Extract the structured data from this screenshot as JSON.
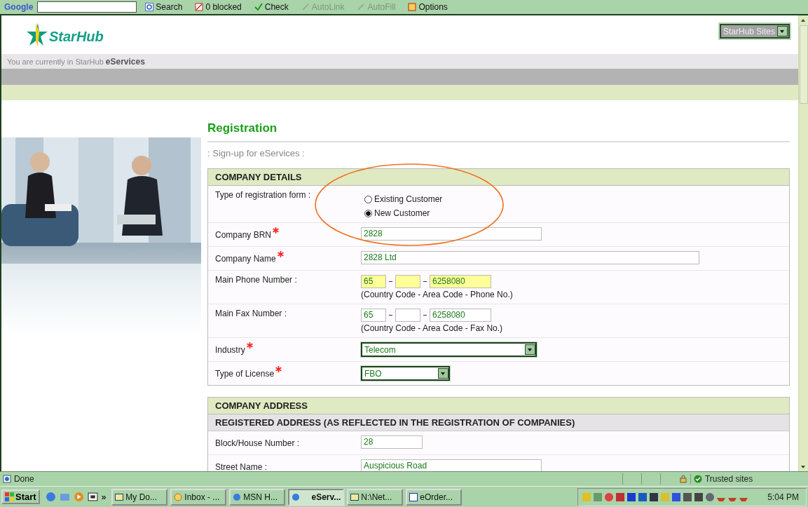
{
  "toolbar": {
    "brand": "Google",
    "items": [
      {
        "label": "Search",
        "kind": "search"
      },
      {
        "label": "0 blocked",
        "kind": "blocked"
      },
      {
        "label": "Check",
        "kind": "check"
      },
      {
        "label": "AutoLink",
        "kind": "disabled"
      },
      {
        "label": "AutoFill",
        "kind": "disabled"
      },
      {
        "label": "Options",
        "kind": "options"
      }
    ]
  },
  "header": {
    "logo": "StarHub",
    "sites_select": "StarHub Sites",
    "breadcrumb": "You are currently in StarHub **eServices**"
  },
  "title": "Registration",
  "subtitle": ": Sign-up for eServices :",
  "sections": [
    {
      "title": "COMPANY DETAILS",
      "rows": [
        {
          "kind": "radio",
          "label": "Type of registration form :",
          "required": false,
          "options": [
            {
              "label": "Existing Customer",
              "selected": false
            },
            {
              "label": "New Customer",
              "selected": true
            }
          ]
        },
        {
          "kind": "text",
          "label": "Company BRN",
          "required": true,
          "value": "2828",
          "wide": false
        },
        {
          "kind": "text",
          "label": "Company Name",
          "required": true,
          "value": "2828 Ltd",
          "wide": true
        },
        {
          "kind": "phone",
          "label": "Main Phone Number :",
          "required": false,
          "parts": [
            {
              "value": "65",
              "highlighted": true
            },
            {
              "highlighted": true
            },
            {
              "value": "6258080",
              "highlighted": true
            }
          ],
          "hint": "(Country Code - Area Code - Phone No.)"
        },
        {
          "kind": "phone",
          "label": "Main Fax Number :",
          "required": false,
          "parts": [
            {
              "value": "65",
              "highlighted": false
            },
            {
              "highlighted": false
            },
            {
              "value": "6258080",
              "highlighted": false
            }
          ],
          "hint": "(Country Code - Area Code - Fax No.)"
        },
        {
          "kind": "select",
          "label": "Industry",
          "required": true,
          "value": "Telecom",
          "wide": true
        },
        {
          "kind": "select",
          "label": "Type of License",
          "required": true,
          "value": "FBO",
          "wide": false
        }
      ]
    },
    {
      "title": "COMPANY ADDRESS",
      "subtitle": "REGISTERED ADDRESS (AS REFLECTED IN THE REGISTRATION OF COMPANIES)",
      "rows": [
        {
          "kind": "text",
          "label": "Block/House Number :",
          "required": false,
          "value": "28",
          "wide": false,
          "short": true
        },
        {
          "kind": "text",
          "label": "Street Name :",
          "required": false,
          "value": "Auspicious Road",
          "wide": false
        }
      ]
    }
  ],
  "status_bar": {
    "text": "Done",
    "zone": "Trusted sites"
  },
  "taskbar": {
    "start": "Start",
    "chevron": "»",
    "tasks": [
      {
        "label": "My Do...",
        "selected": false,
        "kind": "folder"
      },
      {
        "label": "Inbox - ...",
        "selected": false,
        "kind": "mail"
      },
      {
        "label": "MSN H...",
        "selected": false,
        "kind": "browser"
      },
      {
        "label": "eServ...",
        "selected": true,
        "kind": "browser"
      },
      {
        "label": "N:\\Net...",
        "selected": false,
        "kind": "folder"
      },
      {
        "label": "eOrder...",
        "selected": false,
        "kind": "word"
      }
    ],
    "clock": "5:04 PM"
  }
}
